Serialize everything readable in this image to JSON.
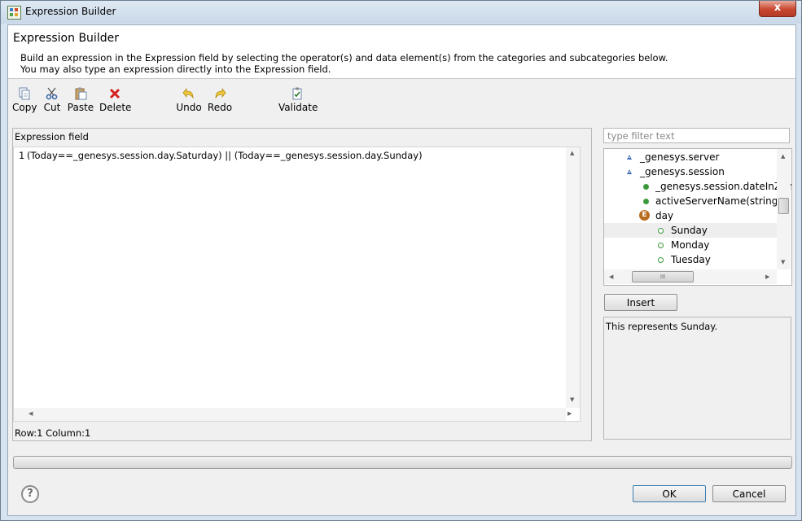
{
  "window": {
    "title": "Expression Builder",
    "close_symbol": "x"
  },
  "header": {
    "title": "Expression Builder",
    "description_line1": "Build an expression in the Expression field by selecting the operator(s) and data element(s) from the categories and subcategories below.",
    "description_line2": "You may also type an expression directly into the Expression field."
  },
  "toolbar": {
    "copy": {
      "label": "Copy",
      "icon": "copy-icon"
    },
    "cut": {
      "label": "Cut",
      "icon": "scissors-icon"
    },
    "paste": {
      "label": "Paste",
      "icon": "paste-icon"
    },
    "delete": {
      "label": "Delete",
      "icon": "red-x-icon"
    },
    "undo": {
      "label": "Undo",
      "icon": "undo-arrow-icon"
    },
    "redo": {
      "label": "Redo",
      "icon": "redo-arrow-icon"
    },
    "validate": {
      "label": "Validate",
      "icon": "validate-icon"
    }
  },
  "expression_panel": {
    "label": "Expression field",
    "line_number": "1",
    "expression": "(Today==_genesys.session.day.Saturday) || (Today==_genesys.session.day.Sunday)",
    "status": "Row:1 Column:1"
  },
  "filter": {
    "placeholder": "type filter text"
  },
  "tree": {
    "items": [
      {
        "label": "_genesys.server",
        "icon": "triangle-icon"
      },
      {
        "label": "_genesys.session",
        "icon": "triangle-icon"
      },
      {
        "label": "_genesys.session.dateInZone",
        "icon": "green-dot-icon"
      },
      {
        "label": "activeServerName(string) : st",
        "icon": "green-dot-icon"
      },
      {
        "label": "day",
        "icon": "enum-icon",
        "icon_letter": "E"
      },
      {
        "label": "Sunday",
        "icon": "hollow-dot-icon",
        "selected": true
      },
      {
        "label": "Monday",
        "icon": "hollow-dot-icon"
      },
      {
        "label": "Tuesday",
        "icon": "hollow-dot-icon"
      }
    ],
    "hscroll_grip": "III"
  },
  "insert_button": "Insert",
  "description_text": "This represents Sunday.",
  "footer": {
    "help_symbol": "?",
    "ok_label": "OK",
    "cancel_label": "Cancel"
  },
  "colors": {
    "titlebar": "#c9d8e8",
    "dialog_bg": "#f0f0f0",
    "close_button": "#c8472f",
    "tree_icon_blue": "#3f6fb5",
    "tree_icon_green": "#3a9a3a",
    "tree_icon_enum": "#b86b1c"
  }
}
